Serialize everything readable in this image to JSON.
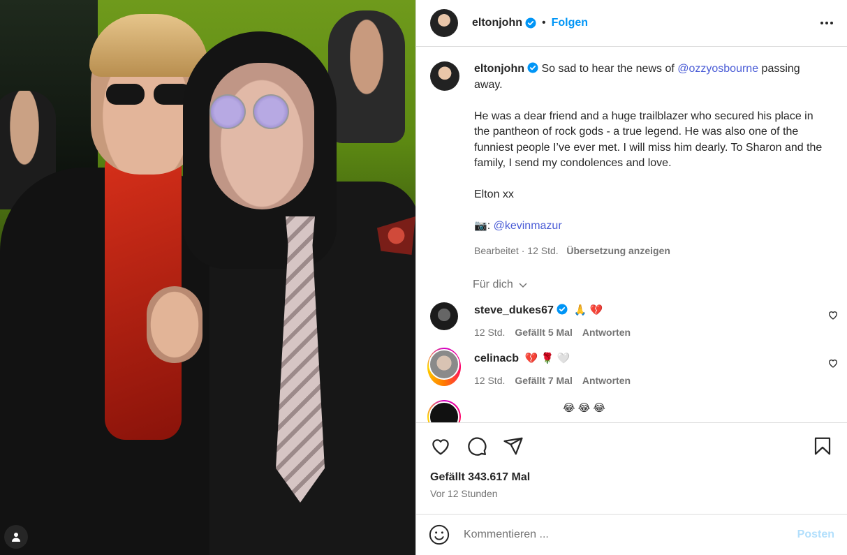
{
  "header": {
    "username": "eltonjohn",
    "separator": "•",
    "follow_label": "Folgen"
  },
  "caption": {
    "username": "eltonjohn",
    "intro": "So sad to hear the news of",
    "mention": "@ozzyosbourne",
    "intro_tail": "passing away.",
    "para2": "He was a dear friend and a huge trailblazer who secured his place in the pantheon of rock gods - a true legend. He was also one of the funniest people I’ve ever met. I will miss him dearly. To Sharon and the family, I send my condolences and love.",
    "signoff": "Elton xx",
    "camera_emoji": "📷",
    "camera_sep": ":",
    "credit_mention": "@kevinmazur",
    "edited_label": "Bearbeitet",
    "meta_sep": "·",
    "age": "12 Std.",
    "translate_label": "Übersetzung anzeigen"
  },
  "for_you": {
    "label": "Für dich"
  },
  "comments": [
    {
      "username": "steve_dukes67",
      "verified": true,
      "text": "🙏 💔",
      "age": "12 Std.",
      "likes": "Gefällt 5 Mal",
      "reply_label": "Antworten"
    },
    {
      "username": "celinacb",
      "verified": false,
      "text": "💔 🌹 🤍",
      "age": "12 Std.",
      "likes": "Gefällt 7 Mal",
      "reply_label": "Antworten"
    },
    {
      "username": "",
      "verified": false,
      "text": "😂 😂 😂",
      "age": "",
      "likes": "",
      "reply_label": ""
    }
  ],
  "footer": {
    "likes_text": "Gefällt 343.617 Mal",
    "time_text": "Vor 12 Stunden",
    "comment_placeholder": "Kommentieren ...",
    "post_label": "Posten"
  },
  "colors": {
    "accent_blue": "#0095f6",
    "mention_blue": "#4a5cd6",
    "secondary_text": "#737373",
    "border": "#dbdbdb"
  },
  "icons": {
    "verified": "verified-badge-icon",
    "more": "more-options-icon",
    "like": "heart-icon",
    "comment": "comment-bubble-icon",
    "share": "paper-plane-icon",
    "save": "bookmark-icon",
    "emoji": "smiley-icon",
    "chevron": "chevron-down-icon",
    "profile": "person-icon"
  }
}
